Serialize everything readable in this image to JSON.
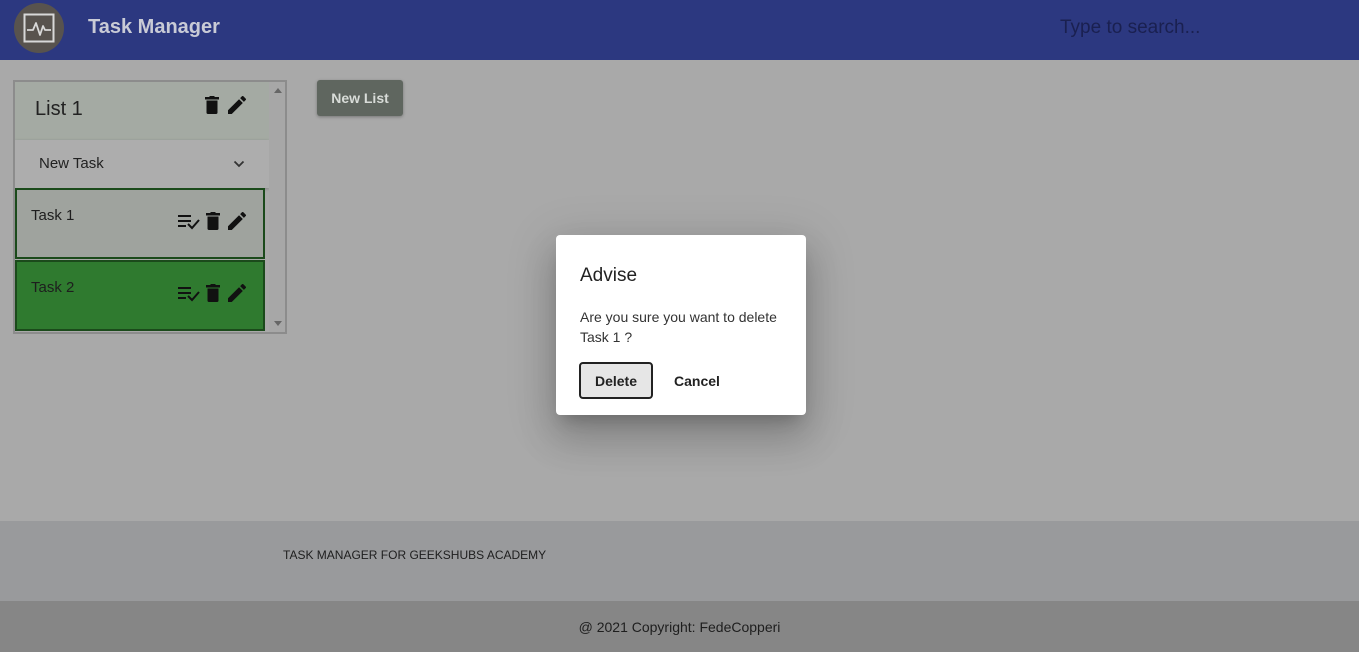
{
  "header": {
    "title": "Task Manager",
    "logo_icon": "activity-monitor-icon",
    "search_placeholder": "Type to search..."
  },
  "lists": [
    {
      "title": "List 1",
      "new_task_label": "New Task",
      "tasks": [
        {
          "label": "Task 1",
          "color": "#9fa39e"
        },
        {
          "label": "Task 2",
          "color": "#2f7a2f"
        }
      ]
    }
  ],
  "new_list_label": "New List",
  "footer": {
    "text": "TASK MANAGER FOR GEEKSHUBS ACADEMY",
    "copyright": "@ 2021 Copyright: FedeCopperi"
  },
  "dialog": {
    "title": "Advise",
    "message": "Are you sure you want to delete Task 1 ?",
    "delete_label": "Delete",
    "cancel_label": "Cancel"
  },
  "colors": {
    "header_bg": "#2c3880",
    "task_done": "#2f7a2f"
  }
}
